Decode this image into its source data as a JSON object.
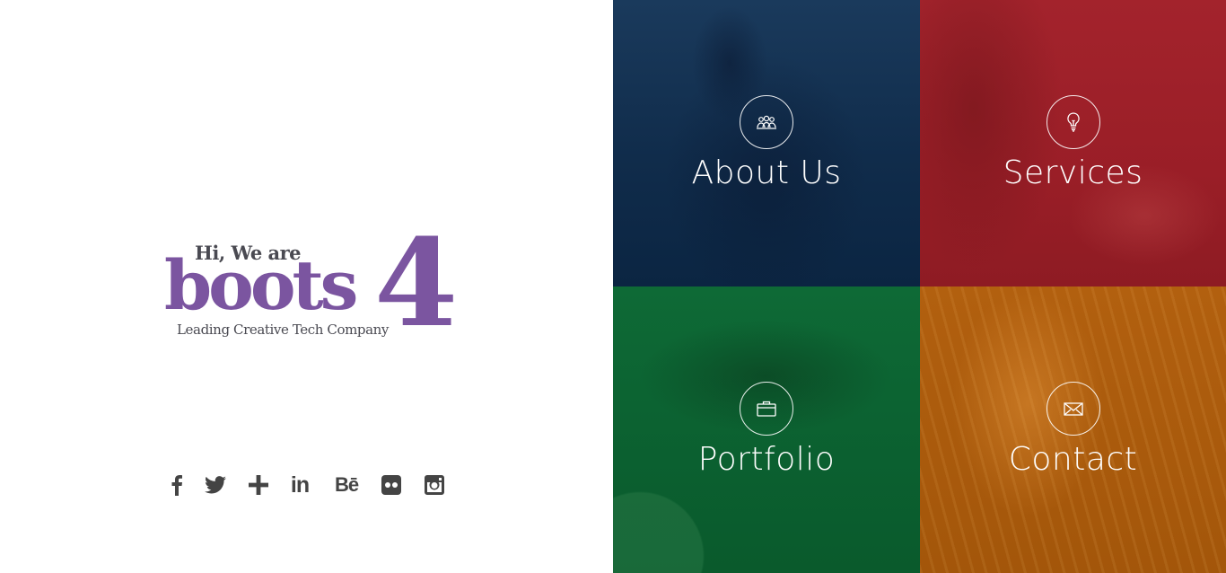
{
  "logo": {
    "greeting": "Hi, We are",
    "brand": "boots",
    "brand_number": "4",
    "tagline": "Leading Creative Tech Company",
    "color": "#7b55a0"
  },
  "social": [
    {
      "name": "facebook-icon"
    },
    {
      "name": "twitter-icon"
    },
    {
      "name": "google-plus-icon"
    },
    {
      "name": "linkedin-icon",
      "text": "in"
    },
    {
      "name": "behance-icon",
      "text": "Bē"
    },
    {
      "name": "flickr-icon"
    },
    {
      "name": "instagram-icon"
    }
  ],
  "tiles": {
    "about": {
      "label": "About Us",
      "icon": "people-icon",
      "color": "#102c4b"
    },
    "services": {
      "label": "Services",
      "icon": "lightbulb-icon",
      "color": "#9a1e27"
    },
    "portfolio": {
      "label": "Portfolio",
      "icon": "briefcase-icon",
      "color": "#0b6030"
    },
    "contact": {
      "label": "Contact",
      "icon": "envelope-icon",
      "color": "#a95a0c"
    }
  }
}
